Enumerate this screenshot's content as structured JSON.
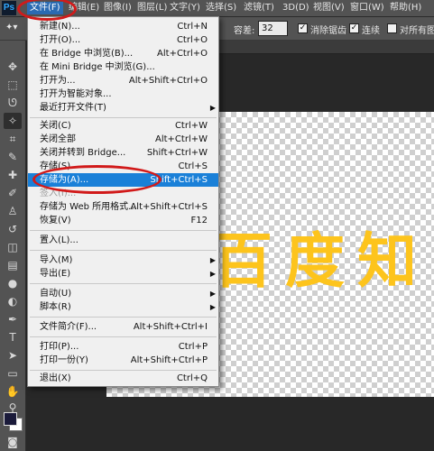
{
  "app": {
    "logo": "Ps"
  },
  "menubar": {
    "items": [
      "文件(F)",
      "编辑(E)",
      "图像(I)",
      "图层(L)",
      "文字(Y)",
      "选择(S)",
      "滤镜(T)",
      "3D(D)",
      "视图(V)",
      "窗口(W)",
      "帮助(H)"
    ]
  },
  "options": {
    "tolerance_label": "容差:",
    "tolerance_value": "32",
    "antialias_label": "消除锯齿",
    "contiguous_label": "连续",
    "all_layers_label": "对所有图层"
  },
  "file_menu": {
    "items": [
      {
        "label": "新建(N)...",
        "shortcut": "Ctrl+N"
      },
      {
        "label": "打开(O)...",
        "shortcut": "Ctrl+O"
      },
      {
        "label": "在 Bridge 中浏览(B)...",
        "shortcut": "Alt+Ctrl+O"
      },
      {
        "label": "在 Mini Bridge 中浏览(G)...",
        "shortcut": ""
      },
      {
        "label": "打开为...",
        "shortcut": "Alt+Shift+Ctrl+O"
      },
      {
        "label": "打开为智能对象...",
        "shortcut": ""
      },
      {
        "label": "最近打开文件(T)",
        "shortcut": ""
      },
      {
        "label": "关闭(C)",
        "shortcut": "Ctrl+W"
      },
      {
        "label": "关闭全部",
        "shortcut": "Alt+Ctrl+W"
      },
      {
        "label": "关闭并转到 Bridge...",
        "shortcut": "Shift+Ctrl+W"
      },
      {
        "label": "存储(S)",
        "shortcut": "Ctrl+S"
      },
      {
        "label": "存储为(A)...",
        "shortcut": "Shift+Ctrl+S"
      },
      {
        "label": "签入(I)...",
        "shortcut": ""
      },
      {
        "label": "存储为 Web 所用格式...",
        "shortcut": "Alt+Shift+Ctrl+S"
      },
      {
        "label": "恢复(V)",
        "shortcut": "F12"
      },
      {
        "label": "置入(L)...",
        "shortcut": ""
      },
      {
        "label": "导入(M)",
        "shortcut": ""
      },
      {
        "label": "导出(E)",
        "shortcut": ""
      },
      {
        "label": "自动(U)",
        "shortcut": ""
      },
      {
        "label": "脚本(R)",
        "shortcut": ""
      },
      {
        "label": "文件简介(F)...",
        "shortcut": "Alt+Shift+Ctrl+I"
      },
      {
        "label": "打印(P)...",
        "shortcut": "Ctrl+P"
      },
      {
        "label": "打印一份(Y)",
        "shortcut": "Alt+Shift+Ctrl+P"
      },
      {
        "label": "退出(X)",
        "shortcut": "Ctrl+Q"
      }
    ]
  },
  "canvas": {
    "text": "百度知"
  }
}
